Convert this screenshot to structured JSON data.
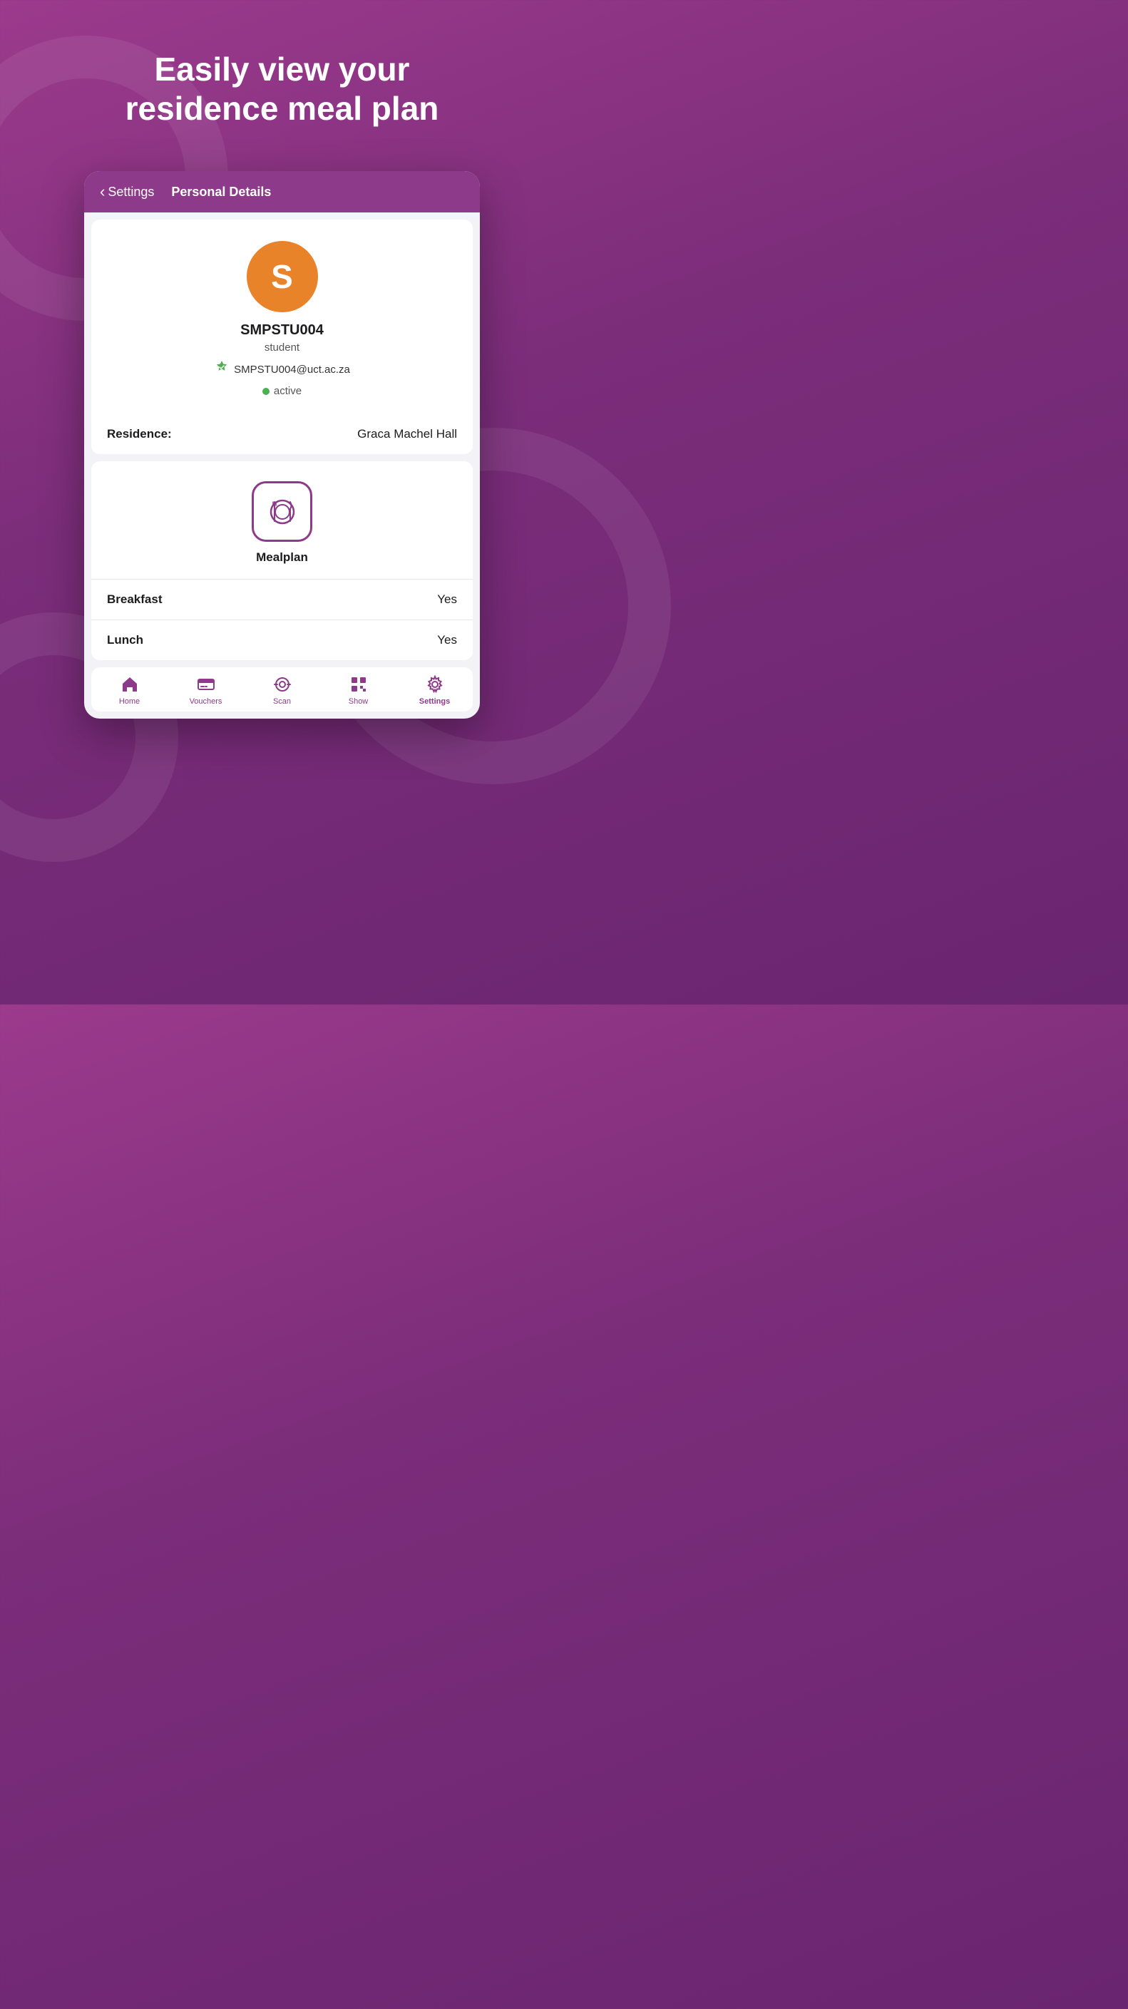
{
  "hero": {
    "title": "Easily view your\nresidence meal plan"
  },
  "nav": {
    "back_label": "Settings",
    "title": "Personal Details",
    "chevron": "‹"
  },
  "profile": {
    "avatar_letter": "S",
    "name": "SMPSTU004",
    "role": "student",
    "email": "SMPSTU004@uct.ac.za",
    "status": "active"
  },
  "residence": {
    "label": "Residence:",
    "value": "Graca Machel Hall"
  },
  "mealplan": {
    "label": "Mealplan"
  },
  "meals": [
    {
      "label": "Breakfast",
      "value": "Yes"
    },
    {
      "label": "Lunch",
      "value": "Yes"
    }
  ],
  "tabs": [
    {
      "label": "Home",
      "icon": "home"
    },
    {
      "label": "Vouchers",
      "icon": "vouchers"
    },
    {
      "label": "Scan",
      "icon": "scan"
    },
    {
      "label": "Show",
      "icon": "show"
    },
    {
      "label": "Settings",
      "icon": "settings",
      "active": true
    }
  ],
  "colors": {
    "purple": "#8e3a8a",
    "orange": "#e8832a",
    "green": "#4CAF50"
  }
}
